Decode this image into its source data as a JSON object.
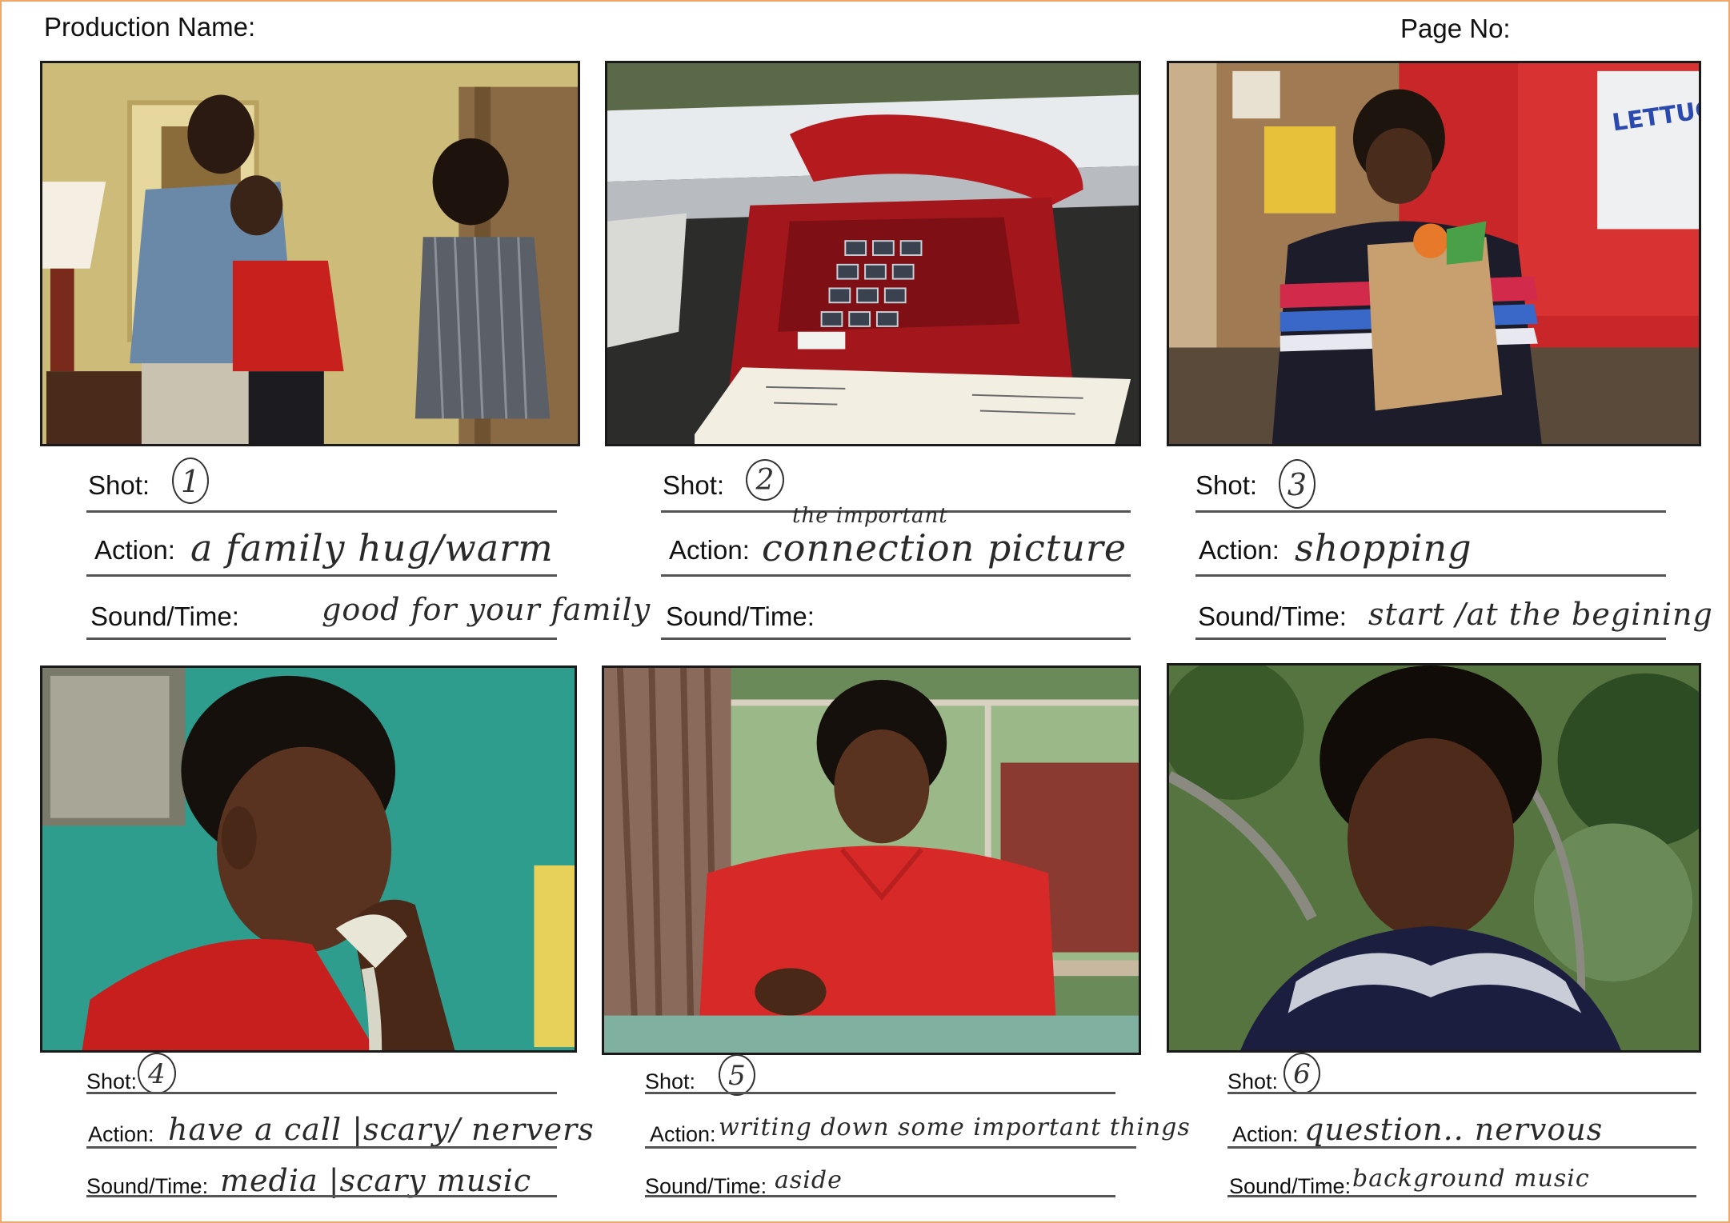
{
  "header": {
    "production_name_label": "Production Name:",
    "page_no_label": "Page No:"
  },
  "labels": {
    "shot": "Shot:",
    "action": "Action:",
    "sound_time": "Sound/Time:"
  },
  "shots": [
    {
      "shot_no": "1",
      "action": "a family hug/warm",
      "sound": "good for your family",
      "pre_note": "",
      "image": "family-hug-scene"
    },
    {
      "shot_no": "2",
      "action": "connection picture",
      "action_note": "the important",
      "sound": "",
      "image": "red-telephone"
    },
    {
      "shot_no": "3",
      "action": "shopping",
      "sound": "start /at the begining",
      "image": "boy-with-grocery-bag"
    },
    {
      "shot_no": "4",
      "action": "have a call |scary/ nervers",
      "sound": "media |scary music",
      "image": "boy-on-phone"
    },
    {
      "shot_no": "5",
      "action": "writing down some important things",
      "sound": "aside",
      "image": "boy-writing"
    },
    {
      "shot_no": "6",
      "action": "question.. nervous",
      "sound": "background music",
      "image": "boy-closeup"
    }
  ]
}
